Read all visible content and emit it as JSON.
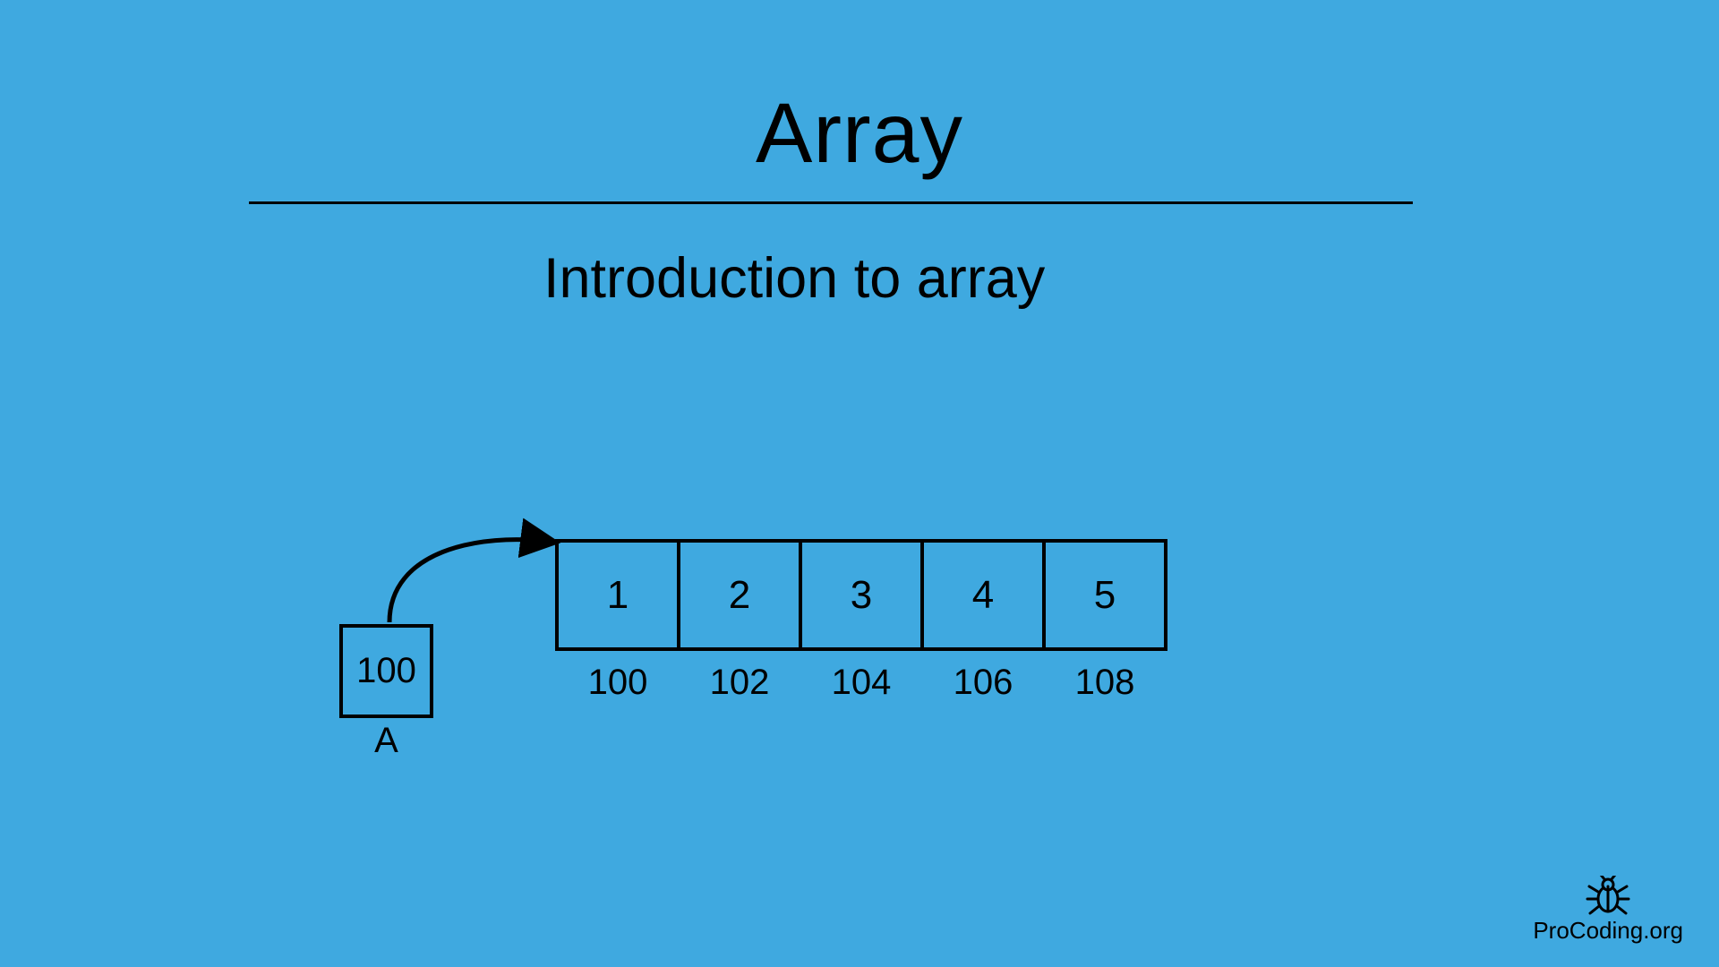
{
  "title": "Array",
  "subtitle": "Introduction to array",
  "pointer": {
    "value": "100",
    "label": "A"
  },
  "array": {
    "values": [
      "1",
      "2",
      "3",
      "4",
      "5"
    ],
    "addresses": [
      "100",
      "102",
      "104",
      "106",
      "108"
    ]
  },
  "brand": "ProCoding.org"
}
